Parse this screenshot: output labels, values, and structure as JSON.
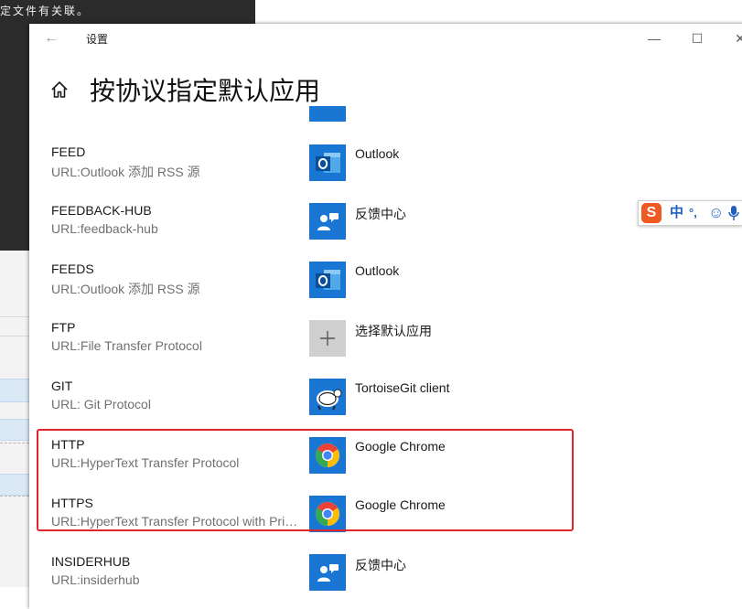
{
  "background_window": {
    "text": "定文件有关联。"
  },
  "window": {
    "title": "设置",
    "back_glyph": "←",
    "controls": {
      "minimize": "—",
      "maximize": "☐",
      "close": "✕"
    }
  },
  "page": {
    "title": "按协议指定默认应用"
  },
  "rows": [
    {
      "name": "FEED",
      "desc": "URL:Outlook 添加 RSS 源",
      "app": "Outlook",
      "icon": "outlook-icon"
    },
    {
      "name": "FEEDBACK-HUB",
      "desc": "URL:feedback-hub",
      "app": "反馈中心",
      "icon": "feedback-hub-icon"
    },
    {
      "name": "FEEDS",
      "desc": "URL:Outlook 添加 RSS 源",
      "app": "Outlook",
      "icon": "outlook-icon"
    },
    {
      "name": "FTP",
      "desc": "URL:File Transfer Protocol",
      "app": "选择默认应用",
      "icon": "plus-icon"
    },
    {
      "name": "GIT",
      "desc": "URL: Git Protocol",
      "app": "TortoiseGit client",
      "icon": "tortoisegit-icon"
    },
    {
      "name": "HTTP",
      "desc": "URL:HyperText Transfer Protocol",
      "app": "Google Chrome",
      "icon": "chrome-icon"
    },
    {
      "name": "HTTPS",
      "desc": "URL:HyperText Transfer Protocol with Privacy",
      "app": "Google Chrome",
      "icon": "chrome-icon"
    },
    {
      "name": "INSIDERHUB",
      "desc": "URL:insiderhub",
      "app": "反馈中心",
      "icon": "feedback-hub-icon"
    }
  ],
  "ime_toolbar": {
    "logo": "S",
    "mode": "中",
    "punct": "°,",
    "emoji": "☺",
    "voice": "mic"
  },
  "colors": {
    "accent": "#1976d2",
    "highlight": "#e3242b"
  }
}
